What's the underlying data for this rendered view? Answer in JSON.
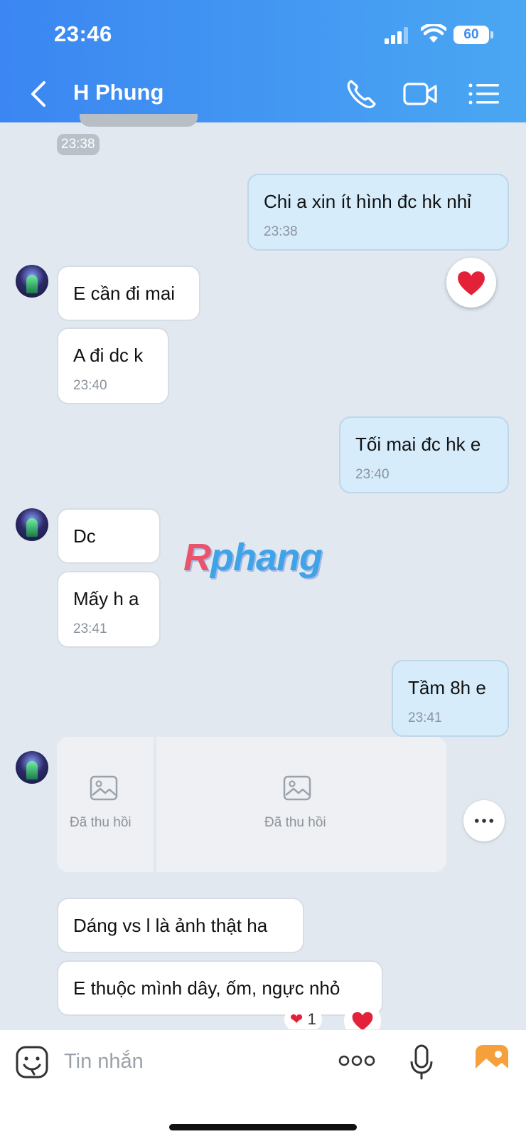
{
  "status_bar": {
    "time": "23:46",
    "battery": "60"
  },
  "header": {
    "contact_name": "H Phung"
  },
  "messages": {
    "top_stamp": "23:38",
    "m1": {
      "text": "Chi a xin ít hình đc hk nhỉ",
      "time": "23:38"
    },
    "m2": {
      "text": "E cần đi mai"
    },
    "m3": {
      "text": "A đi dc k",
      "time": "23:40"
    },
    "m4": {
      "text": "Tối mai đc hk e",
      "time": "23:40"
    },
    "m5": {
      "text": "Dc"
    },
    "m6": {
      "text": "Mấy h a",
      "time": "23:41"
    },
    "m7": {
      "text": "Tầm 8h e",
      "time": "23:41"
    },
    "recalled": {
      "label1": "Đã thu hồi",
      "label2": "Đã thu hồi"
    },
    "m8": {
      "text": "Dáng vs l là ảnh thật ha"
    },
    "m9": {
      "text": "E thuộc mình dây, ốm, ngực nhỏ"
    },
    "reaction_count": "1"
  },
  "watermark": {
    "part1": "R",
    "part2": "phang"
  },
  "input": {
    "placeholder": "Tin nhắn"
  },
  "colors": {
    "header_start": "#3b86f2",
    "header_end": "#4aa7f2",
    "outgoing_bubble": "#d6ecfb",
    "heart": "#e3223a"
  },
  "icons": [
    "back-icon",
    "phone-icon",
    "video-icon",
    "menu-list-icon",
    "emoji-sticker-icon",
    "more-dots-icon",
    "microphone-icon",
    "gallery-icon",
    "image-placeholder-icon",
    "heart-icon"
  ]
}
